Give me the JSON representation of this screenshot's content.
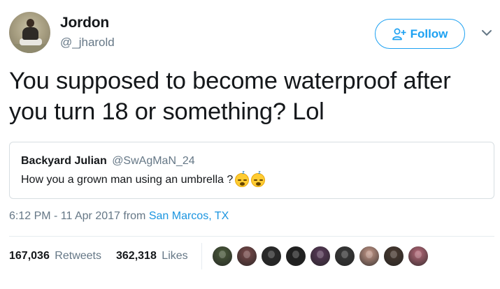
{
  "user": {
    "name": "Jordon",
    "handle": "@_jharold"
  },
  "follow_button": {
    "label": "Follow",
    "icon": "add-user-icon",
    "color": "#1da1f2"
  },
  "menu": {
    "icon": "chevron-down-icon"
  },
  "tweet": {
    "text": "You supposed to become waterproof after you turn 18 or something? Lol"
  },
  "quoted_tweet": {
    "name": "Backyard Julian",
    "handle": "@SwAgMaN_24",
    "text": "How you a grown man using an umbrella ?",
    "emojis": [
      "sleeping-face-icon",
      "sleeping-face-icon"
    ]
  },
  "timestamp": {
    "time_date": "6:12 PM - 11 Apr 2017",
    "from_label": "from",
    "location": "San Marcos, TX"
  },
  "stats": {
    "retweets_count": "167,036",
    "retweets_label": "Retweets",
    "likes_count": "362,318",
    "likes_label": "Likes"
  },
  "liker_avatars": [
    {
      "name": "liker-avatar-1",
      "color": "#4a5a3a"
    },
    {
      "name": "liker-avatar-2",
      "color": "#7a4a4a"
    },
    {
      "name": "liker-avatar-3",
      "color": "#2b2b2b"
    },
    {
      "name": "liker-avatar-4",
      "color": "#1f1f1f"
    },
    {
      "name": "liker-avatar-5",
      "color": "#5a3a5a"
    },
    {
      "name": "liker-avatar-6",
      "color": "#3a3a3a"
    },
    {
      "name": "liker-avatar-7",
      "color": "#c89a8a"
    },
    {
      "name": "liker-avatar-8",
      "color": "#4a3a30"
    },
    {
      "name": "liker-avatar-9",
      "color": "#b86a7a"
    }
  ],
  "colors": {
    "text": "#14171a",
    "muted": "#657786",
    "link": "#1b95e0",
    "border": "#d7dee2"
  }
}
